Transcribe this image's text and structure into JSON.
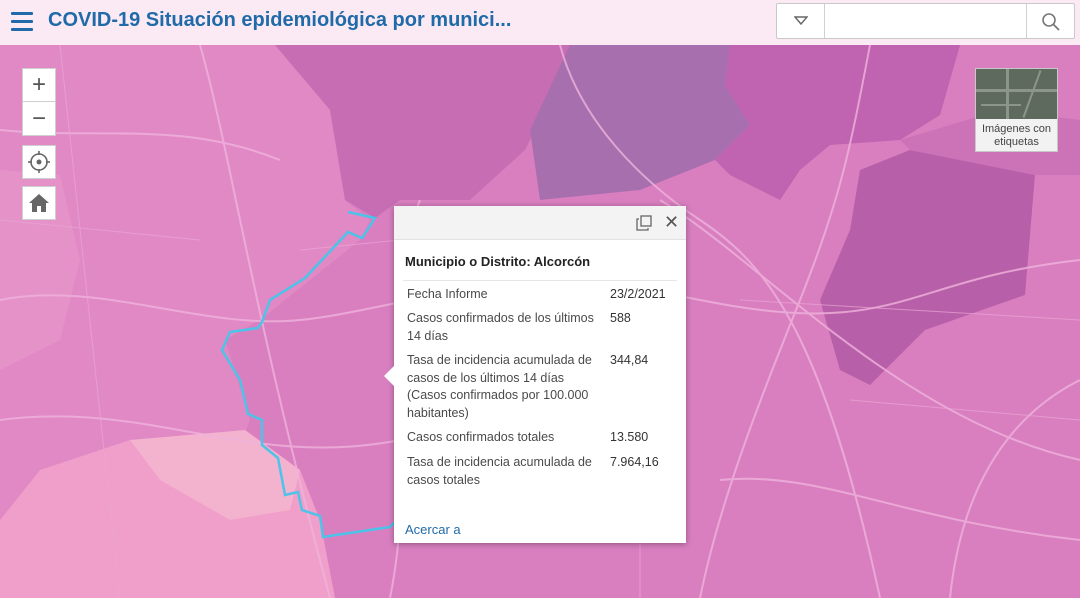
{
  "header": {
    "title": "COVID-19 Situación epidemiológica por munici...",
    "menu_icon": "hamburger-menu-icon",
    "search_placeholder": "",
    "search_dropdown_icon": "chevron-down-icon",
    "search_icon": "search-icon",
    "title_color": "#1f6aa8"
  },
  "map_controls": {
    "zoom_in": "+",
    "zoom_out": "−",
    "locate_icon": "locate-icon",
    "home_icon": "home-icon"
  },
  "basemap": {
    "label": "Imágenes con etiquetas"
  },
  "popup": {
    "title": "Municipio o Distrito: Alcorcón",
    "fields": [
      {
        "label": "Fecha Informe",
        "value": "23/2/2021"
      },
      {
        "label": "Casos confirmados de los últimos 14 días",
        "value": "588"
      },
      {
        "label": "Tasa de incidencia acumulada de casos de los últimos 14 días (Casos confirmados por 100.000 habitantes)",
        "value": "344,84"
      },
      {
        "label": "Casos confirmados totales",
        "value": "13.580"
      },
      {
        "label": "Tasa de incidencia acumulada de casos totales",
        "value": "7.964,16"
      }
    ],
    "zoom_link": "Acercar a"
  },
  "map_colors": {
    "base": "#d97fc0",
    "light": "#ec9cc8",
    "lighter": "#f2acc8",
    "dark": "#b661a9",
    "purple": "#a26aae",
    "selection": "#4cc3e8"
  }
}
